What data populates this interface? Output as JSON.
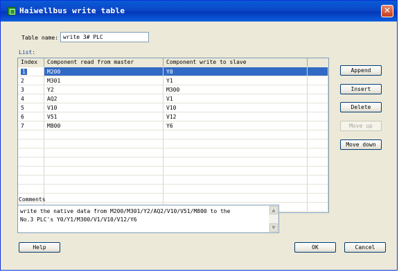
{
  "window": {
    "title": "Haiwellbus write table",
    "close_glyph": "✕"
  },
  "table_name": {
    "label": "Table name:",
    "value": "write 3# PLC"
  },
  "list": {
    "label": "List:",
    "columns": [
      "Index",
      "Component read from master",
      "Component write to slave"
    ],
    "rows": [
      [
        "1",
        "M200",
        "Y0"
      ],
      [
        "2",
        "M301",
        "Y1"
      ],
      [
        "3",
        "Y2",
        "M300"
      ],
      [
        "4",
        "AQ2",
        "V1"
      ],
      [
        "5",
        "V10",
        "V10"
      ],
      [
        "6",
        "V51",
        "V12"
      ],
      [
        "7",
        "M800",
        "Y6"
      ]
    ],
    "selected_index": 0
  },
  "buttons": {
    "append": "Append",
    "insert": "Insert",
    "delete": "Delete",
    "move_up": "Move up",
    "move_down": "Move down",
    "help": "Help",
    "ok": "OK",
    "cancel": "Cancel"
  },
  "comments": {
    "label": "Comments",
    "text": "write the native data from M200/M301/Y2/AQ2/V10/V51/M800 to the\nNo.3 PLC's Y0/Y1/M300/V1/V10/V12/Y6"
  },
  "icons": {
    "app": "table-app-icon",
    "close": "close-icon"
  },
  "colors": {
    "title_bar": "#0a5bd6",
    "selection": "#316ac5",
    "close_button": "#c83d1a"
  }
}
